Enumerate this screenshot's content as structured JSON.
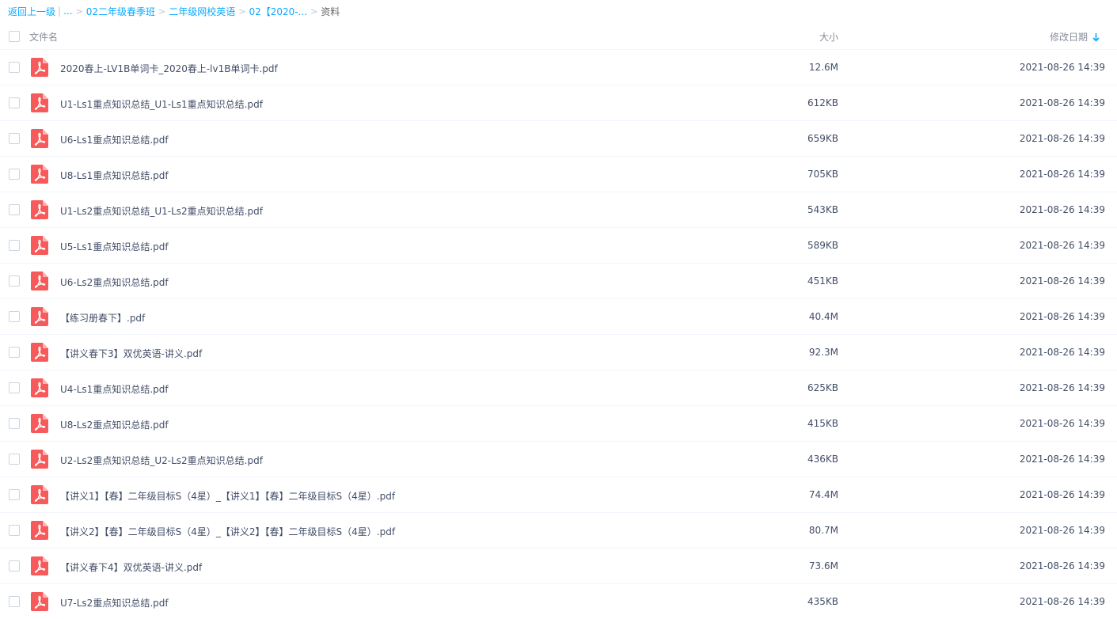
{
  "breadcrumb": {
    "back": "返回上一级",
    "ellipsis": "...",
    "items": [
      "02二年级春季班",
      "二年级网校英语",
      "02【2020-..."
    ],
    "current": "资料"
  },
  "header": {
    "name": "文件名",
    "size": "大小",
    "date": "修改日期",
    "sort_icon": "arrow-down-icon"
  },
  "colors": {
    "link": "#09aaff",
    "pdf": "#f65a5a",
    "text": "#424e67"
  },
  "files": [
    {
      "name": "2020春上-LV1B单词卡_2020春上-lv1B单词卡.pdf",
      "size": "12.6M",
      "date": "2021-08-26 14:39"
    },
    {
      "name": "U1-Ls1重点知识总结_U1-Ls1重点知识总结.pdf",
      "size": "612KB",
      "date": "2021-08-26 14:39"
    },
    {
      "name": "U6-Ls1重点知识总结.pdf",
      "size": "659KB",
      "date": "2021-08-26 14:39"
    },
    {
      "name": "U8-Ls1重点知识总结.pdf",
      "size": "705KB",
      "date": "2021-08-26 14:39"
    },
    {
      "name": "U1-Ls2重点知识总结_U1-Ls2重点知识总结.pdf",
      "size": "543KB",
      "date": "2021-08-26 14:39"
    },
    {
      "name": "U5-Ls1重点知识总结.pdf",
      "size": "589KB",
      "date": "2021-08-26 14:39"
    },
    {
      "name": "U6-Ls2重点知识总结.pdf",
      "size": "451KB",
      "date": "2021-08-26 14:39"
    },
    {
      "name": "【练习册春下】.pdf",
      "size": "40.4M",
      "date": "2021-08-26 14:39"
    },
    {
      "name": "【讲义春下3】双优英语-讲义.pdf",
      "size": "92.3M",
      "date": "2021-08-26 14:39"
    },
    {
      "name": "U4-Ls1重点知识总结.pdf",
      "size": "625KB",
      "date": "2021-08-26 14:39"
    },
    {
      "name": "U8-Ls2重点知识总结.pdf",
      "size": "415KB",
      "date": "2021-08-26 14:39"
    },
    {
      "name": "U2-Ls2重点知识总结_U2-Ls2重点知识总结.pdf",
      "size": "436KB",
      "date": "2021-08-26 14:39"
    },
    {
      "name": "【讲义1】【春】二年级目标S（4星）_【讲义1】【春】二年级目标S（4星）.pdf",
      "size": "74.4M",
      "date": "2021-08-26 14:39"
    },
    {
      "name": "【讲义2】【春】二年级目标S（4星）_【讲义2】【春】二年级目标S（4星）.pdf",
      "size": "80.7M",
      "date": "2021-08-26 14:39"
    },
    {
      "name": "【讲义春下4】双优英语-讲义.pdf",
      "size": "73.6M",
      "date": "2021-08-26 14:39"
    },
    {
      "name": "U7-Ls2重点知识总结.pdf",
      "size": "435KB",
      "date": "2021-08-26 14:39"
    }
  ]
}
